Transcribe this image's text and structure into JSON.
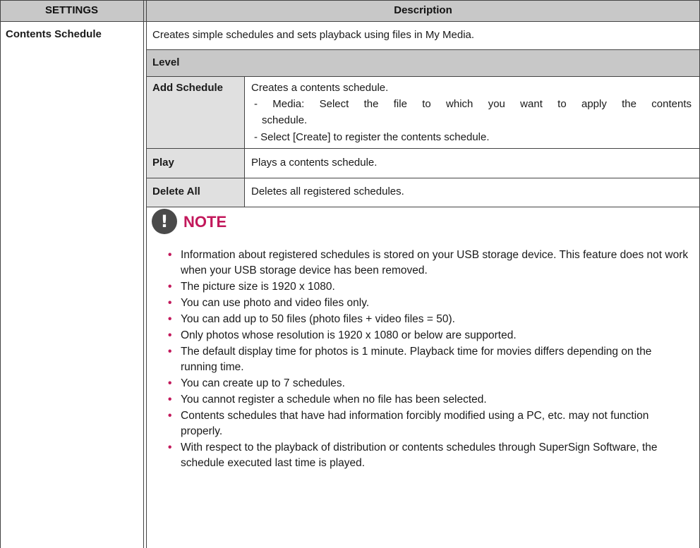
{
  "header": {
    "settings_label": "SETTINGS",
    "description_label": "Description"
  },
  "row": {
    "setting_name": "Contents Schedule",
    "summary": "Creates simple schedules and sets playback using files in My Media."
  },
  "level_label": "Level",
  "subrows": [
    {
      "name": "Add Schedule",
      "lines": [
        "Creates a contents schedule.",
        "- Media: Select the file to which you want to apply the contents",
        "schedule.",
        "- Select [Create] to register the contents schedule."
      ]
    },
    {
      "name": "Play",
      "lines": [
        "Plays a contents schedule."
      ]
    },
    {
      "name": "Delete All",
      "lines": [
        "Deletes all registered schedules."
      ]
    }
  ],
  "note": {
    "icon": "exclamation-icon",
    "title": "NOTE",
    "items": [
      "Information about registered schedules is stored on your USB storage device. This feature does not work when your USB storage device has been removed.",
      "The picture size is 1920 x 1080.",
      "You can use photo and video files only.",
      "You can add up to 50 files (photo files + video files = 50).",
      "Only photos whose resolution is 1920 x 1080 or below are supported.",
      "The default display time for photos is 1 minute. Playback time for movies differs depending on the running time.",
      "You can create up to 7 schedules.",
      "You cannot register a schedule when no file has been selected.",
      "Contents schedules that have had information forcibly modified using a PC, etc. may not function properly.",
      "With respect to the playback of distribution or contents schedules through SuperSign Software, the schedule executed last time is played."
    ]
  },
  "colors": {
    "header_bg": "#c8c8c8",
    "subrow_bg": "#e0e0e0",
    "accent": "#c2185b",
    "border": "#444444"
  }
}
